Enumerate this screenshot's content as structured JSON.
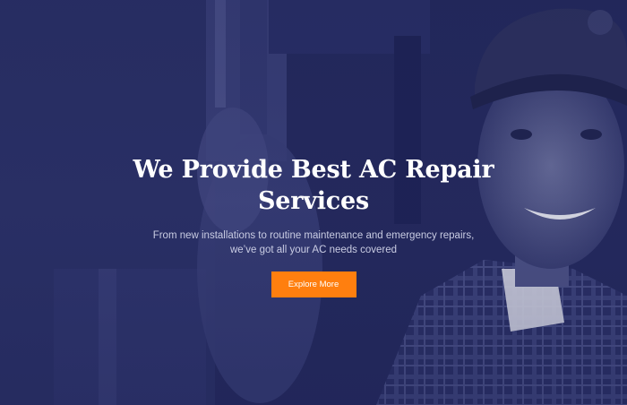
{
  "hero": {
    "title_line_1": "We Provide Best AC Repair",
    "title_line_2": "Services",
    "subtitle_line_1": "From new installations to routine maintenance and emergency repairs,",
    "subtitle_line_2": "we’ve got all your AC needs covered",
    "button_label": "Explore More",
    "background_image": "technician-repairing-ac-photo"
  },
  "colors": {
    "overlay": "#22285a",
    "accent": "#ff7f0f",
    "title": "#ffffff",
    "subtitle": "#c9cce3"
  }
}
